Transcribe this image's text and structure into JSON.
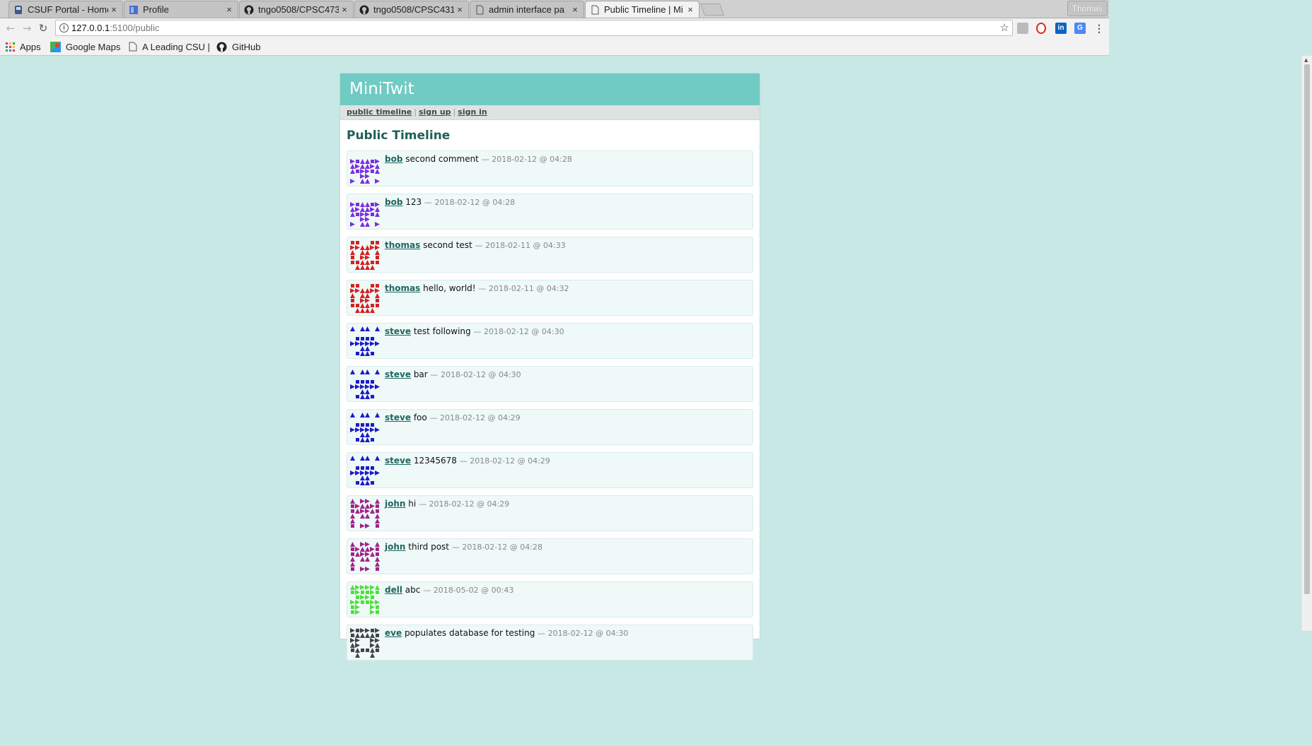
{
  "browser": {
    "tabs": [
      {
        "title": "CSUF Portal - Home",
        "icon": "csuf-portal-icon",
        "active": false
      },
      {
        "title": "Profile",
        "icon": "profile-page-icon",
        "active": false
      },
      {
        "title": "tngo0508/CPSC473",
        "icon": "github-icon",
        "active": false
      },
      {
        "title": "tngo0508/CPSC431",
        "icon": "github-icon",
        "active": false
      },
      {
        "title": "admin interface pa",
        "icon": "page-icon",
        "active": false
      },
      {
        "title": "Public Timeline | Mi",
        "icon": "page-icon",
        "active": true
      }
    ],
    "tab_close": "×",
    "profile_name": "Thomas",
    "url_host": "127.0.0.1",
    "url_path": ":5100/public",
    "bookmarks": [
      {
        "label": "Apps",
        "icon": "apps-grid-icon"
      },
      {
        "label": "Google Maps",
        "icon": "google-maps-icon"
      },
      {
        "label": "A Leading CSU |",
        "icon": "page-icon"
      },
      {
        "label": "GitHub",
        "icon": "github-icon"
      }
    ],
    "colors": {
      "accent": "#6fcbc3",
      "background": "#c8e8e6"
    }
  },
  "site": {
    "title": "MiniTwit",
    "nav": {
      "public_timeline": "public timeline",
      "sign_up": "sign up",
      "sign_in": "sign in",
      "separator": "|"
    },
    "heading": "Public Timeline"
  },
  "messages": [
    {
      "user": "bob",
      "text": "second comment",
      "date": "— 2018-02-12 @ 04:28",
      "avatar_color": "#7b2fe0"
    },
    {
      "user": "bob",
      "text": "123",
      "date": "— 2018-02-12 @ 04:28",
      "avatar_color": "#7b2fe0"
    },
    {
      "user": "thomas",
      "text": "second test",
      "date": "— 2018-02-11 @ 04:33",
      "avatar_color": "#d42121"
    },
    {
      "user": "thomas",
      "text": "hello, world!",
      "date": "— 2018-02-11 @ 04:32",
      "avatar_color": "#d42121"
    },
    {
      "user": "steve",
      "text": "test following",
      "date": "— 2018-02-12 @ 04:30",
      "avatar_color": "#1c1cc8"
    },
    {
      "user": "steve",
      "text": "bar",
      "date": "— 2018-02-12 @ 04:30",
      "avatar_color": "#1c1cc8"
    },
    {
      "user": "steve",
      "text": "foo",
      "date": "— 2018-02-12 @ 04:29",
      "avatar_color": "#1c1cc8"
    },
    {
      "user": "steve",
      "text": "12345678",
      "date": "— 2018-02-12 @ 04:29",
      "avatar_color": "#1c1cc8"
    },
    {
      "user": "john",
      "text": "hi",
      "date": "— 2018-02-12 @ 04:29",
      "avatar_color": "#a0248a"
    },
    {
      "user": "john",
      "text": "third post",
      "date": "— 2018-02-12 @ 04:28",
      "avatar_color": "#a0248a"
    },
    {
      "user": "dell",
      "text": "abc",
      "date": "— 2018-05-02 @ 00:43",
      "avatar_color": "#4ee03a"
    },
    {
      "user": "eve",
      "text": "populates database for testing",
      "date": "— 2018-02-12 @ 04:30",
      "avatar_color": "#444444"
    }
  ]
}
